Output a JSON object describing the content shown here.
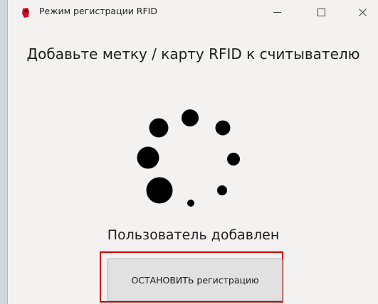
{
  "window": {
    "title": "Режим регистрации RFID",
    "controls": {
      "minimize": "minimize-icon",
      "maximize": "maximize-icon",
      "close": "close-icon"
    }
  },
  "main": {
    "heading": "Добавьте метку / карту RFID к считывателю",
    "status": "Пользователь добавлен",
    "stop_button_label": "ОСТАНОВИТЬ регистрацию"
  },
  "spinner": {
    "icon": "loading-spinner-icon",
    "dot_count": 8,
    "color": "#000000"
  },
  "colors": {
    "highlight_border": "#d40000",
    "window_background": "#f4f1f1",
    "button_background": "#e1e1e1"
  }
}
